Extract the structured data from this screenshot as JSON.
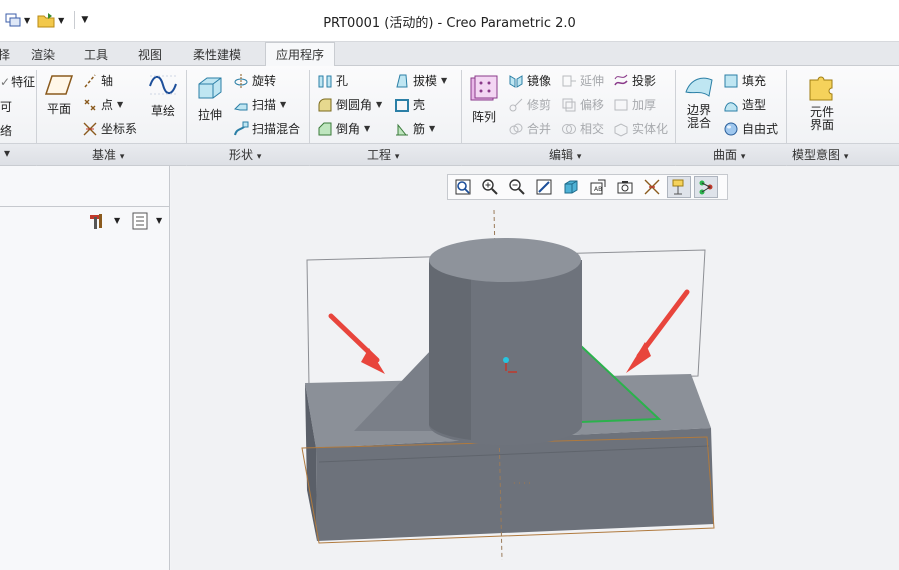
{
  "window": {
    "title": "PRT0001 (活动的) - Creo Parametric 2.0"
  },
  "tabs": [
    {
      "label": "择"
    },
    {
      "label": "渲染"
    },
    {
      "label": "工具"
    },
    {
      "label": "视图"
    },
    {
      "label": "柔性建模"
    },
    {
      "label": "应用程序"
    }
  ],
  "ribbon": {
    "partial_left": {
      "item1": "特征",
      "item2": "可",
      "item3": "络"
    },
    "datum": {
      "plane": "平面",
      "axis": "轴",
      "point": "点",
      "csys": "坐标系",
      "sketch": "草绘"
    },
    "shapes": {
      "extrude": "拉伸",
      "revolve": "旋转",
      "sweep": "扫描",
      "swept_blend": "扫描混合"
    },
    "engineering": {
      "hole": "孔",
      "round": "倒圆角",
      "chamfer": "倒角",
      "draft": "拔模",
      "shell": "壳",
      "rib": "筋"
    },
    "editing": {
      "pattern": "阵列",
      "mirror": "镜像",
      "extend": "延伸",
      "project": "投影",
      "trim": "修剪",
      "offset": "偏移",
      "thicken": "加厚",
      "merge": "合并",
      "intersect": "相交",
      "solidify": "实体化"
    },
    "surfaces": {
      "boundary_blend_1": "边界",
      "boundary_blend_2": "混合",
      "fill": "填充",
      "style": "造型",
      "freestyle": "自由式"
    },
    "model_intent": {
      "component_interface_1": "元件",
      "component_interface_2": "界面"
    }
  },
  "groups": {
    "datum": "基准",
    "shapes": "形状",
    "engineering": "工程",
    "editing": "编辑",
    "surfaces": "曲面",
    "model_intent": "模型意图"
  },
  "colors": {
    "model": "#7d828b",
    "model_dark": "#5d626b",
    "selection": "#2bb24c",
    "arrow": "#e8453c",
    "datum": "#b07a3e"
  }
}
